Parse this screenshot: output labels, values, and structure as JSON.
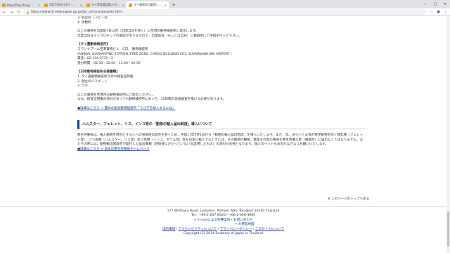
{
  "browser": {
    "tabs": [
      {
        "label": "Blog [Dog Diary] Meleoie: yomo...",
        "active": false
      },
      {
        "label": "2021年6月12日 - 大日日本へのご...",
        "active": false
      },
      {
        "label": "タイ等家電話無人日本から...",
        "active": false
      },
      {
        "label": "タイ事務室広範囲 | 在タイ日本国大使...",
        "active": true
      }
    ],
    "new_tab": "+",
    "window_controls": [
      "−",
      "□",
      "✕"
    ],
    "url": "https://www.th.emb-japan.go.jp/itpr_ja/consular/pets.html",
    "back": "←",
    "forward": "→",
    "reload": "↻"
  },
  "content": {
    "lines_top": [
      "3. 航空券（コピー可）",
      "4. 手数料"
    ],
    "para1": [
      "以上の書類を出国前3日以内（出国当日を除く）に空港の動物検疫所に提出します。",
      "出発当日はマイクロチップの確認がありますので、出国前日（もしくは当日）に検疫所にて手続を行って下さい。"
    ],
    "office_heading": "【タイ農動物検疫所】",
    "office_lines": [
      "スワンナプーム空港貨物ビル　CE1　動物検疫所",
      "(ANIMAL QUARANTINE STATION, FREE ZONE, CARGO BUILDING CE1, SUVARNABHUMI AIRPORT )",
      "電話：02-134-0731～2",
      "受付時間：08:30～12:00・13:00～16:30"
    ],
    "japan_heading": "【日本動物検疫所必要書類】",
    "japan_items": [
      "1. タイ農動物検疫所交付の検査証明書",
      "2. 飼主のパスポート",
      "3. ラボ"
    ],
    "para2": [
      "以上の書類を空港内の動物検疫所にご提出ください。",
      "なお、検査証明書の添付があっても動物検疫所において、10日間の係留検査を受ける必要があります。"
    ],
    "detail_link1": "●詳細はこちら → 農林水産省動物検疫所「うさぎを輸入するには」",
    "section_title": "ハムスター、フェレット、リス、インコ等の「動物の輸入届出制度」導入について",
    "section_para": "厚生労働省は、輸入動物を原因とする人への感染症の発生を防ぐため、平成17年9月1日から「動物の輸入届出制度」を導入いたします。また、鳥、あらいぐま等の特定動物を除く哺乳類（フェレット等）、げっ歯類（ハムスター、リス等）及び鳥類（インコ、オウム等）等を日本に輸入するときには、その動物の種類、数量その他の事項を厚生労働大臣（検疫所）に届出なくてはなりません。またその際には、動物輸出国政府が発行した届出書類（感染症にかかっていない旨証明したもの）の添付が必要となります。個人のペットもお忘れなきようお願いいたします。",
    "detail_link2": "●詳細はこちら → 日本の厚生労働省ホームページ",
    "to_top": "このページのトップへ戻る"
  },
  "footer": {
    "address": "177 Witthayu Road, Lumphini, Pathum Wan, Bangkok 10330 Thailand",
    "tel": "Tel：+66-2-207-8500 / +66-2-696-3000",
    "email_link": "→ E-mailによる各種案内・お問い合わせ",
    "map_link": "→ 大使館地図",
    "links": [
      "法的事項",
      "アクセシビリティについて",
      "プライバシーポリシー",
      "このサイトについて"
    ],
    "copyright": "Copyright (C) 2014 Embassy of Japan in Thailand"
  }
}
